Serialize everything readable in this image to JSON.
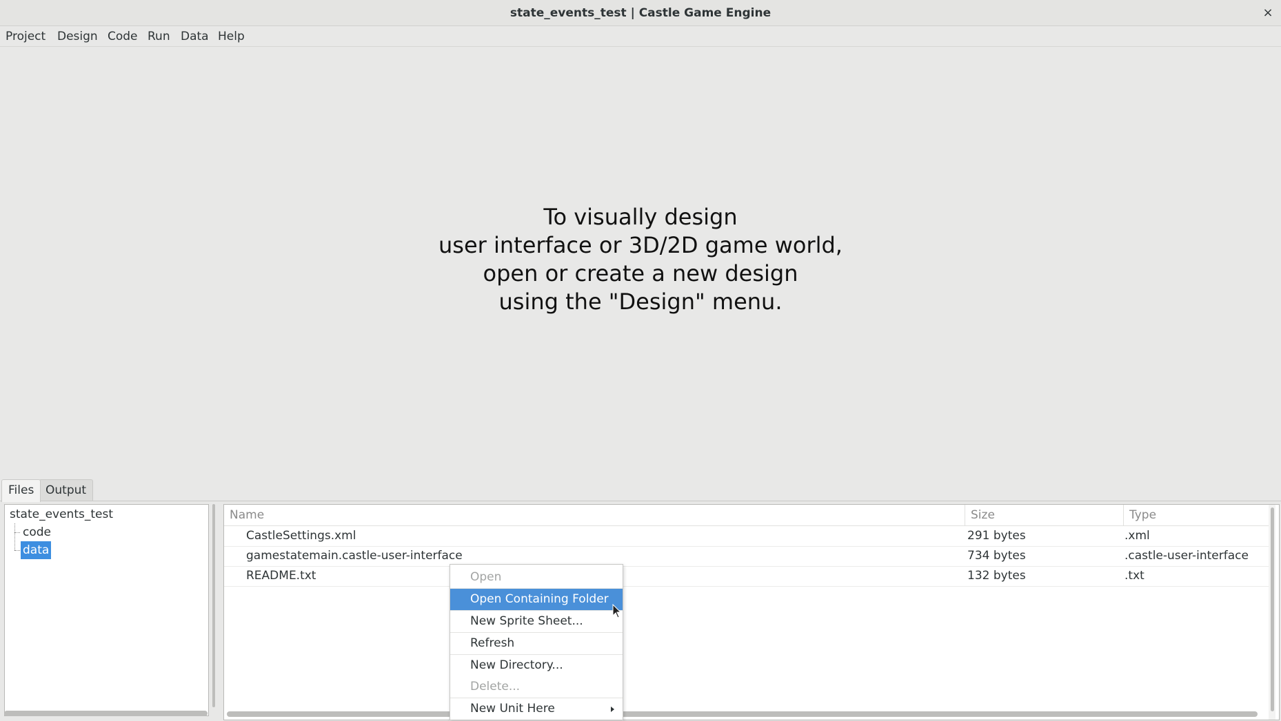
{
  "window": {
    "title": "state_events_test | Castle Game Engine",
    "close_glyph": "×"
  },
  "menubar": {
    "items": [
      "Project",
      "Design",
      "Code",
      "Run",
      "Data",
      "Help"
    ]
  },
  "design_area": {
    "message_lines": [
      "To visually design",
      "user interface or 3D/2D game world,",
      "open or create a new design",
      "using the \"Design\" menu."
    ]
  },
  "bottom_tabs": {
    "items": [
      "Files",
      "Output"
    ],
    "active": "Files"
  },
  "tree": {
    "root": "state_events_test",
    "children": [
      "code",
      "data"
    ],
    "selected": "data"
  },
  "file_list": {
    "columns": [
      "Name",
      "Size",
      "Type"
    ],
    "rows": [
      {
        "name": "CastleSettings.xml",
        "size": "291 bytes",
        "type": ".xml"
      },
      {
        "name": "gamestatemain.castle-user-interface",
        "size": "734 bytes",
        "type": ".castle-user-interface"
      },
      {
        "name": "README.txt",
        "size": "132 bytes",
        "type": ".txt"
      }
    ]
  },
  "context_menu": {
    "items": [
      {
        "label": "Open",
        "state": "disabled"
      },
      {
        "label": "Open Containing Folder",
        "state": "highlighted"
      },
      {
        "label": "New Sprite Sheet...",
        "state": "normal"
      },
      {
        "label": "Refresh",
        "state": "normal"
      },
      {
        "label": "New Directory...",
        "state": "normal"
      },
      {
        "label": "Delete...",
        "state": "disabled"
      },
      {
        "label": "New Unit Here",
        "state": "normal",
        "submenu": true
      }
    ]
  },
  "colors": {
    "selection": "#3d8ee0",
    "menu_highlight": "#4a90d9",
    "disabled_text": "#a2a4a3"
  }
}
